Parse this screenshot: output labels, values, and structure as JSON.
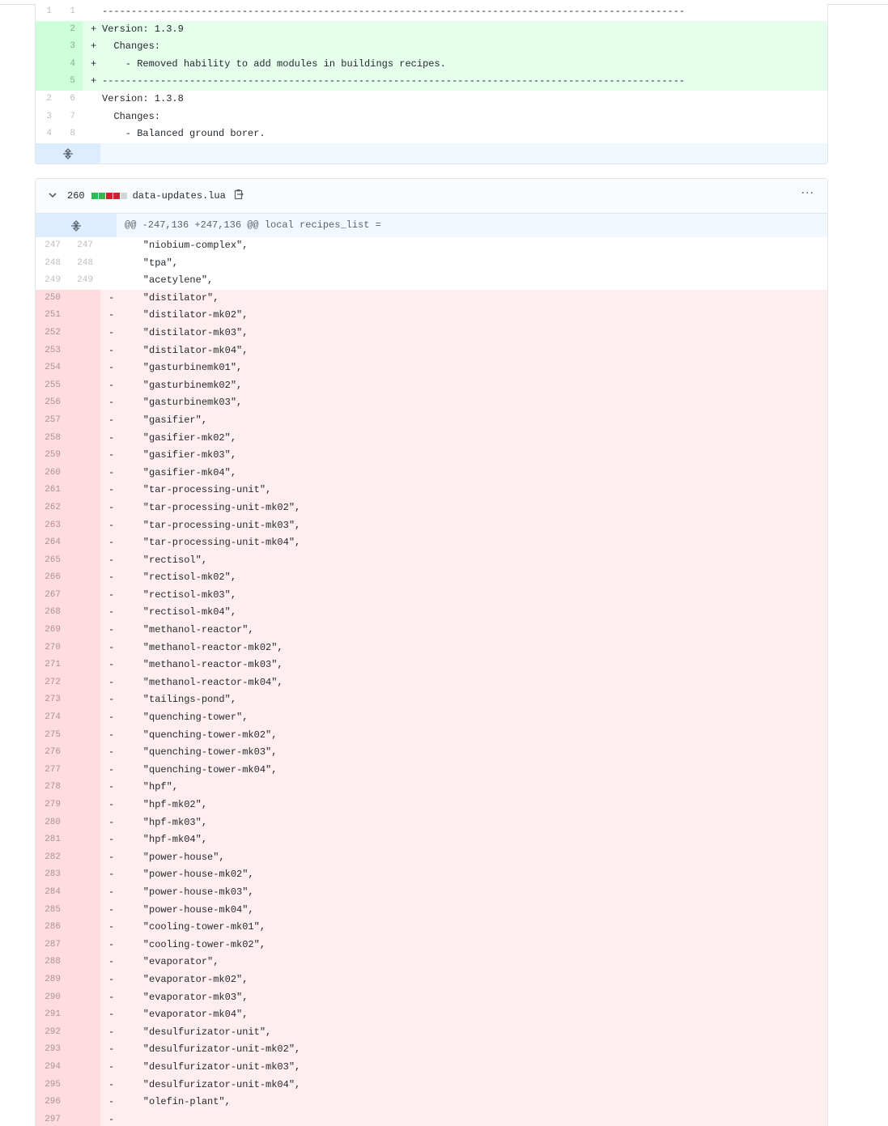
{
  "file1": {
    "lines": [
      {
        "type": "ctx",
        "old": "1",
        "new": "1",
        "sign": " ",
        "text": "----------------------------------------------------------------------------------------------------"
      },
      {
        "type": "add",
        "old": "",
        "new": "2",
        "sign": "+",
        "text": "Version: 1.3.9"
      },
      {
        "type": "add",
        "old": "",
        "new": "3",
        "sign": "+",
        "text": "  Changes:"
      },
      {
        "type": "add",
        "old": "",
        "new": "4",
        "sign": "+",
        "text": "    - Removed hability to add modules in buildings recipes."
      },
      {
        "type": "add",
        "old": "",
        "new": "5",
        "sign": "+",
        "text": "----------------------------------------------------------------------------------------------------"
      },
      {
        "type": "ctx",
        "old": "2",
        "new": "6",
        "sign": " ",
        "text": "Version: 1.3.8"
      },
      {
        "type": "ctx",
        "old": "3",
        "new": "7",
        "sign": " ",
        "text": "  Changes:"
      },
      {
        "type": "ctx",
        "old": "4",
        "new": "8",
        "sign": " ",
        "text": "    - Balanced ground borer."
      }
    ],
    "expand_icon": "unfold-icon"
  },
  "file2": {
    "changes_count": "260",
    "diffstat_colors": [
      "#2cbe4e",
      "#2cbe4e",
      "#cb2431",
      "#cb2431",
      "#d1d5da"
    ],
    "filename": "data-updates.lua",
    "hunk_header": "@@ -247,136 +247,136 @@ local recipes_list =",
    "more_label": "···",
    "lines": [
      {
        "type": "ctx",
        "old": "247",
        "new": "247",
        "sign": " ",
        "text": "    \"niobium-complex\","
      },
      {
        "type": "ctx",
        "old": "248",
        "new": "248",
        "sign": " ",
        "text": "    \"tpa\","
      },
      {
        "type": "ctx",
        "old": "249",
        "new": "249",
        "sign": " ",
        "text": "    \"acetylene\","
      },
      {
        "type": "del",
        "old": "250",
        "new": "",
        "sign": "-",
        "text": "    \"distilator\","
      },
      {
        "type": "del",
        "old": "251",
        "new": "",
        "sign": "-",
        "text": "    \"distilator-mk02\","
      },
      {
        "type": "del",
        "old": "252",
        "new": "",
        "sign": "-",
        "text": "    \"distilator-mk03\","
      },
      {
        "type": "del",
        "old": "253",
        "new": "",
        "sign": "-",
        "text": "    \"distilator-mk04\","
      },
      {
        "type": "del",
        "old": "254",
        "new": "",
        "sign": "-",
        "text": "    \"gasturbinemk01\","
      },
      {
        "type": "del",
        "old": "255",
        "new": "",
        "sign": "-",
        "text": "    \"gasturbinemk02\","
      },
      {
        "type": "del",
        "old": "256",
        "new": "",
        "sign": "-",
        "text": "    \"gasturbinemk03\","
      },
      {
        "type": "del",
        "old": "257",
        "new": "",
        "sign": "-",
        "text": "    \"gasifier\","
      },
      {
        "type": "del",
        "old": "258",
        "new": "",
        "sign": "-",
        "text": "    \"gasifier-mk02\","
      },
      {
        "type": "del",
        "old": "259",
        "new": "",
        "sign": "-",
        "text": "    \"gasifier-mk03\","
      },
      {
        "type": "del",
        "old": "260",
        "new": "",
        "sign": "-",
        "text": "    \"gasifier-mk04\","
      },
      {
        "type": "del",
        "old": "261",
        "new": "",
        "sign": "-",
        "text": "    \"tar-processing-unit\","
      },
      {
        "type": "del",
        "old": "262",
        "new": "",
        "sign": "-",
        "text": "    \"tar-processing-unit-mk02\","
      },
      {
        "type": "del",
        "old": "263",
        "new": "",
        "sign": "-",
        "text": "    \"tar-processing-unit-mk03\","
      },
      {
        "type": "del",
        "old": "264",
        "new": "",
        "sign": "-",
        "text": "    \"tar-processing-unit-mk04\","
      },
      {
        "type": "del",
        "old": "265",
        "new": "",
        "sign": "-",
        "text": "    \"rectisol\","
      },
      {
        "type": "del",
        "old": "266",
        "new": "",
        "sign": "-",
        "text": "    \"rectisol-mk02\","
      },
      {
        "type": "del",
        "old": "267",
        "new": "",
        "sign": "-",
        "text": "    \"rectisol-mk03\","
      },
      {
        "type": "del",
        "old": "268",
        "new": "",
        "sign": "-",
        "text": "    \"rectisol-mk04\","
      },
      {
        "type": "del",
        "old": "269",
        "new": "",
        "sign": "-",
        "text": "    \"methanol-reactor\","
      },
      {
        "type": "del",
        "old": "270",
        "new": "",
        "sign": "-",
        "text": "    \"methanol-reactor-mk02\","
      },
      {
        "type": "del",
        "old": "271",
        "new": "",
        "sign": "-",
        "text": "    \"methanol-reactor-mk03\","
      },
      {
        "type": "del",
        "old": "272",
        "new": "",
        "sign": "-",
        "text": "    \"methanol-reactor-mk04\","
      },
      {
        "type": "del",
        "old": "273",
        "new": "",
        "sign": "-",
        "text": "    \"tailings-pond\","
      },
      {
        "type": "del",
        "old": "274",
        "new": "",
        "sign": "-",
        "text": "    \"quenching-tower\","
      },
      {
        "type": "del",
        "old": "275",
        "new": "",
        "sign": "-",
        "text": "    \"quenching-tower-mk02\","
      },
      {
        "type": "del",
        "old": "276",
        "new": "",
        "sign": "-",
        "text": "    \"quenching-tower-mk03\","
      },
      {
        "type": "del",
        "old": "277",
        "new": "",
        "sign": "-",
        "text": "    \"quenching-tower-mk04\","
      },
      {
        "type": "del",
        "old": "278",
        "new": "",
        "sign": "-",
        "text": "    \"hpf\","
      },
      {
        "type": "del",
        "old": "279",
        "new": "",
        "sign": "-",
        "text": "    \"hpf-mk02\","
      },
      {
        "type": "del",
        "old": "280",
        "new": "",
        "sign": "-",
        "text": "    \"hpf-mk03\","
      },
      {
        "type": "del",
        "old": "281",
        "new": "",
        "sign": "-",
        "text": "    \"hpf-mk04\","
      },
      {
        "type": "del",
        "old": "282",
        "new": "",
        "sign": "-",
        "text": "    \"power-house\","
      },
      {
        "type": "del",
        "old": "283",
        "new": "",
        "sign": "-",
        "text": "    \"power-house-mk02\","
      },
      {
        "type": "del",
        "old": "284",
        "new": "",
        "sign": "-",
        "text": "    \"power-house-mk03\","
      },
      {
        "type": "del",
        "old": "285",
        "new": "",
        "sign": "-",
        "text": "    \"power-house-mk04\","
      },
      {
        "type": "del",
        "old": "286",
        "new": "",
        "sign": "-",
        "text": "    \"cooling-tower-mk01\","
      },
      {
        "type": "del",
        "old": "287",
        "new": "",
        "sign": "-",
        "text": "    \"cooling-tower-mk02\","
      },
      {
        "type": "del",
        "old": "288",
        "new": "",
        "sign": "-",
        "text": "    \"evaporator\","
      },
      {
        "type": "del",
        "old": "289",
        "new": "",
        "sign": "-",
        "text": "    \"evaporator-mk02\","
      },
      {
        "type": "del",
        "old": "290",
        "new": "",
        "sign": "-",
        "text": "    \"evaporator-mk03\","
      },
      {
        "type": "del",
        "old": "291",
        "new": "",
        "sign": "-",
        "text": "    \"evaporator-mk04\","
      },
      {
        "type": "del",
        "old": "292",
        "new": "",
        "sign": "-",
        "text": "    \"desulfurizator-unit\","
      },
      {
        "type": "del",
        "old": "293",
        "new": "",
        "sign": "-",
        "text": "    \"desulfurizator-unit-mk02\","
      },
      {
        "type": "del",
        "old": "294",
        "new": "",
        "sign": "-",
        "text": "    \"desulfurizator-unit-mk03\","
      },
      {
        "type": "del",
        "old": "295",
        "new": "",
        "sign": "-",
        "text": "    \"desulfurizator-unit-mk04\","
      },
      {
        "type": "del",
        "old": "296",
        "new": "",
        "sign": "-",
        "text": "    \"olefin-plant\","
      },
      {
        "type": "del",
        "old": "297",
        "new": "",
        "sign": "-",
        "text": ""
      }
    ]
  },
  "icons": {
    "collapse": "chevron-down-icon",
    "copy": "clipboard-icon",
    "expand": "unfold-icon",
    "more": "kebab-horizontal-icon"
  }
}
